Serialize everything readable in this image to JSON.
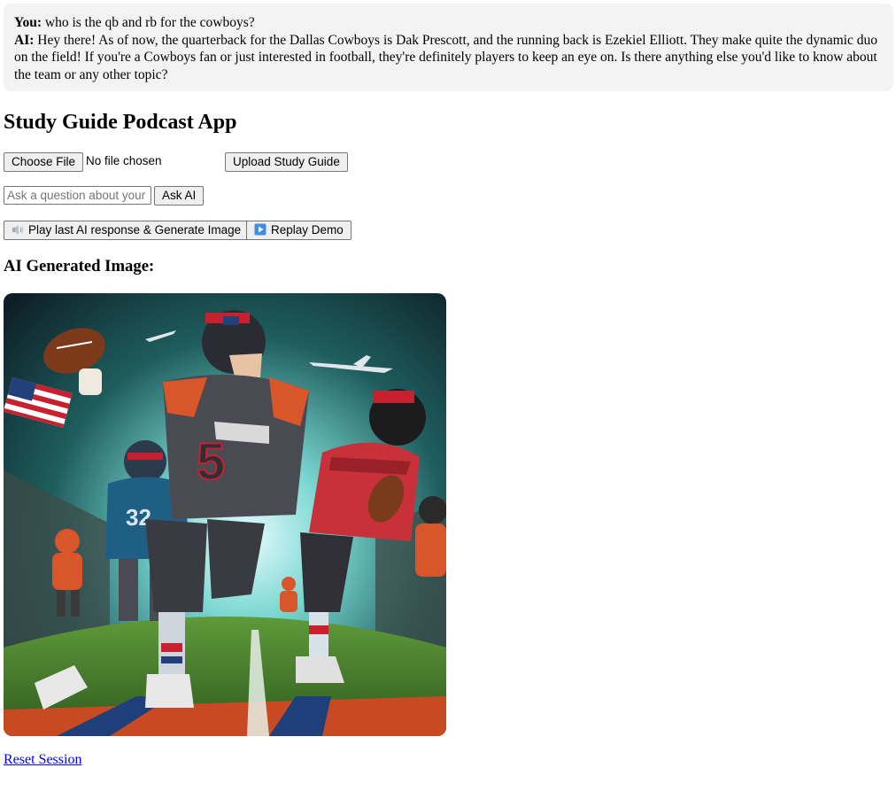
{
  "chat": {
    "you_label": "You:",
    "you_text": "who is the qb and rb for the cowboys?",
    "ai_label": "AI:",
    "ai_text": "Hey there! As of now, the quarterback for the Dallas Cowboys is Dak Prescott, and the running back is Ezekiel Elliott. They make quite the dynamic duo on the field! If you're a Cowboys fan or just interested in football, they're definitely players to keep an eye on. Is there anything else you'd like to know about the team or any other topic?"
  },
  "page_title": "Study Guide Podcast App",
  "upload": {
    "choose_file_label": "Choose File",
    "file_status": "No file chosen",
    "upload_button_label": "Upload Study Guide"
  },
  "ask": {
    "placeholder": "Ask a question about your study guide",
    "button_label": "Ask AI"
  },
  "actions": {
    "play_label": "Play last AI response & Generate Image",
    "play_icon": "speaker-icon",
    "replay_label": "Replay Demo",
    "replay_icon": "play-icon"
  },
  "image_section": {
    "heading": "AI Generated Image:",
    "image_description_icon": "football-players-image"
  },
  "reset_link_label": "Reset Session",
  "colors": {
    "chat_bg": "#f3f3f3",
    "link": "#0000ee",
    "button_bg": "#efefef",
    "button_border": "#767676"
  }
}
